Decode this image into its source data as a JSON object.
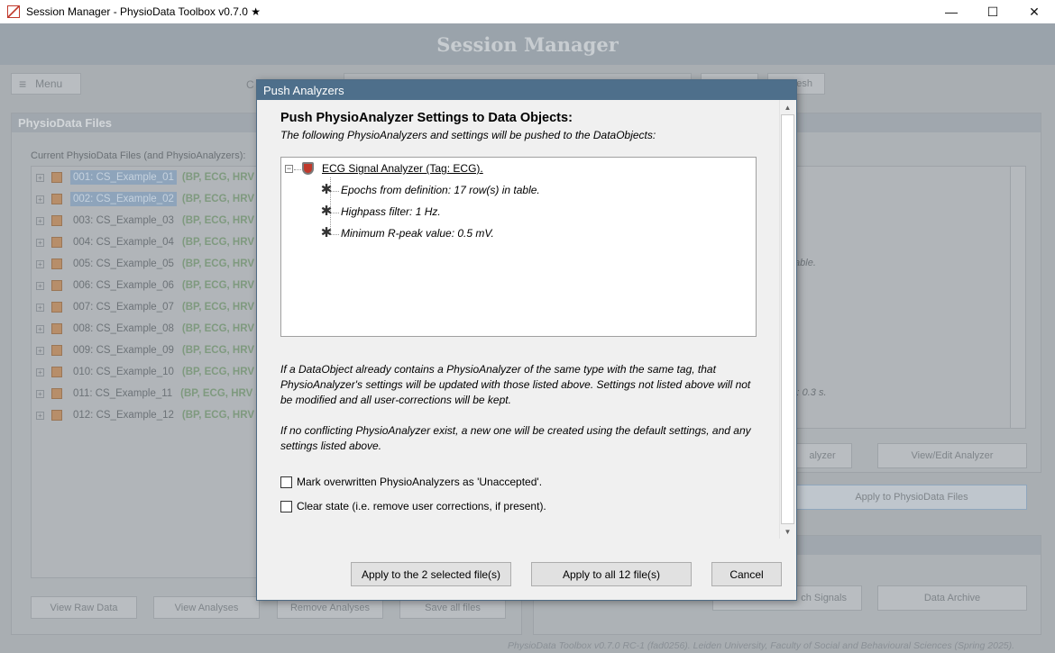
{
  "window": {
    "title": "Session Manager - PhysioData Toolbox v0.7.0 ★",
    "minimize_glyph": "—",
    "maximize_glyph": "☐",
    "close_glyph": "✕"
  },
  "banner": {
    "title": "Session Manager"
  },
  "toolbar": {
    "menu_label": "Menu",
    "menu_icon": "≡",
    "refresh_fragment": "esh",
    "c_fragment": "C"
  },
  "left_panel": {
    "title": "PhysioData Files",
    "list_label": "Current PhysioData Files (and PhysioAnalyzers):",
    "files": [
      {
        "name": "001: CS_Example_01",
        "tags": "(BP, ECG, HRV a",
        "selected": true
      },
      {
        "name": "002: CS_Example_02",
        "tags": "(BP, ECG, HRV a",
        "selected": true
      },
      {
        "name": "003: CS_Example_03",
        "tags": "(BP, ECG, HRV a",
        "selected": false
      },
      {
        "name": "004: CS_Example_04",
        "tags": "(BP, ECG, HRV a",
        "selected": false
      },
      {
        "name": "005: CS_Example_05",
        "tags": "(BP, ECG, HRV a",
        "selected": false
      },
      {
        "name": "006: CS_Example_06",
        "tags": "(BP, ECG, HRV a",
        "selected": false
      },
      {
        "name": "007: CS_Example_07",
        "tags": "(BP, ECG, HRV a",
        "selected": false
      },
      {
        "name": "008: CS_Example_08",
        "tags": "(BP, ECG, HRV a",
        "selected": false
      },
      {
        "name": "009: CS_Example_09",
        "tags": "(BP, ECG, HRV a",
        "selected": false
      },
      {
        "name": "010: CS_Example_10",
        "tags": "(BP, ECG, HRV a",
        "selected": false
      },
      {
        "name": "011: CS_Example_11",
        "tags": "(BP, ECG, HRV a",
        "selected": false
      },
      {
        "name": "012: CS_Example_12",
        "tags": "(BP, ECG, HRV a",
        "selected": false
      }
    ],
    "buttons": {
      "view_raw": "View Raw Data",
      "view_analyses": "View Analyses",
      "remove_analyses": "Remove Analyses",
      "save_all": "Save all files"
    }
  },
  "right_panel": {
    "text_fragment_table": "table.",
    "text_fragment_s": "s: 0.3 s.",
    "btn_analyzer_fragment": "alyzer",
    "btn_view_edit": "View/Edit Analyzer",
    "btn_apply": "Apply to PhysioData Files",
    "btn_signals_fragment": "ch Signals",
    "btn_data_archive": "Data Archive"
  },
  "dialog": {
    "title": "Push Analyzers",
    "heading": "Push PhysioAnalyzer Settings to Data Objects:",
    "subheading": "The following PhysioAnalyzers and settings will be pushed to the DataObjects:",
    "tree": {
      "root_label": "ECG Signal Analyzer (Tag: ECG).",
      "children": [
        "Epochs from definition: 17 row(s) in table.",
        "Highpass filter: 1 Hz.",
        "Minimum R-peak value: 0.5 mV."
      ]
    },
    "paragraph1": "If a DataObject already contains a PhysioAnalyzer of the same type with the same tag, that PhysioAnalyzer's settings will be updated with those listed above. Settings not listed above will not be modified and all user-corrections will be kept.",
    "paragraph2": "If no conflicting PhysioAnalyzer exist, a new one will be created using the default settings, and any settings listed above.",
    "checkbox1": "Mark overwritten PhysioAnalyzers as 'Unaccepted'.",
    "checkbox2": "Clear state (i.e. remove user corrections, if present).",
    "btn_apply_selected": "Apply to the 2 selected file(s)",
    "btn_apply_all": "Apply to all 12 file(s)",
    "btn_cancel": "Cancel"
  },
  "footer": "PhysioData Toolbox v0.7.0 RC-1 (fad0256). Leiden University, Faculty of Social and Behavioural Sciences (Spring 2025)."
}
